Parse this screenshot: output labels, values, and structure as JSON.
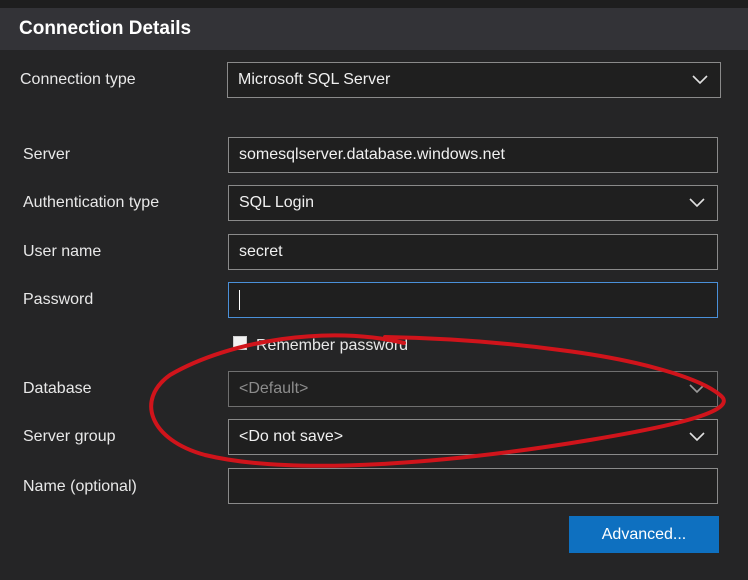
{
  "header": {
    "title": "Connection Details"
  },
  "form": {
    "connection_type": {
      "label": "Connection type",
      "value": "Microsoft SQL Server"
    },
    "server": {
      "label": "Server",
      "value": "somesqlserver.database.windows.net"
    },
    "authentication_type": {
      "label": "Authentication type",
      "value": "SQL Login"
    },
    "user_name": {
      "label": "User name",
      "value": "secret"
    },
    "password": {
      "label": "Password",
      "value": ""
    },
    "remember_password": {
      "label": "Remember password",
      "checked": false
    },
    "database": {
      "label": "Database",
      "placeholder": "<Default>"
    },
    "server_group": {
      "label": "Server group",
      "value": "<Do not save>"
    },
    "name_optional": {
      "label": "Name (optional)",
      "value": ""
    },
    "advanced_button": {
      "label": "Advanced..."
    }
  },
  "colors": {
    "background": "#252526",
    "header_bg": "#333337",
    "field_border": "#8a8a8a",
    "focus_border": "#4a90d9",
    "button_bg": "#0e70c0",
    "annotation_red": "#d0141b"
  },
  "icons": {
    "dropdown": "chevron-down-icon"
  }
}
